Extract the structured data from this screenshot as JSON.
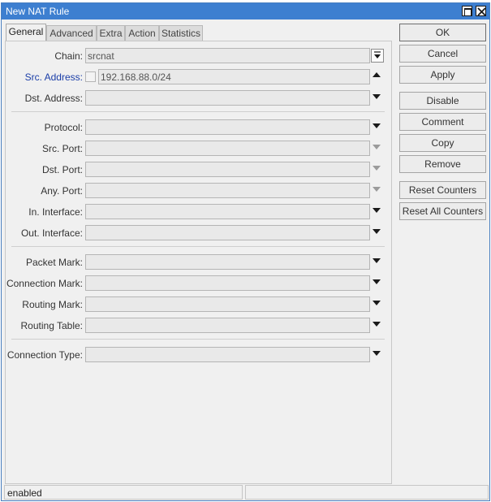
{
  "window": {
    "title": "New NAT Rule"
  },
  "tabs": [
    {
      "label": "General",
      "active": true
    },
    {
      "label": "Advanced",
      "active": false
    },
    {
      "label": "Extra",
      "active": false
    },
    {
      "label": "Action",
      "active": false
    },
    {
      "label": "Statistics",
      "active": false
    }
  ],
  "fields": {
    "chain": {
      "label": "Chain:",
      "value": "srcnat"
    },
    "src_address": {
      "label": "Src. Address:",
      "value": "192.168.88.0/24",
      "negate_checked": false
    },
    "dst_address": {
      "label": "Dst. Address:",
      "value": ""
    },
    "protocol": {
      "label": "Protocol:",
      "value": ""
    },
    "src_port": {
      "label": "Src. Port:",
      "value": ""
    },
    "dst_port": {
      "label": "Dst. Port:",
      "value": ""
    },
    "any_port": {
      "label": "Any. Port:",
      "value": ""
    },
    "in_interface": {
      "label": "In. Interface:",
      "value": ""
    },
    "out_interface": {
      "label": "Out. Interface:",
      "value": ""
    },
    "packet_mark": {
      "label": "Packet Mark:",
      "value": ""
    },
    "connection_mark": {
      "label": "Connection Mark:",
      "value": ""
    },
    "routing_mark": {
      "label": "Routing Mark:",
      "value": ""
    },
    "routing_table": {
      "label": "Routing Table:",
      "value": ""
    },
    "connection_type": {
      "label": "Connection Type:",
      "value": ""
    }
  },
  "buttons": {
    "ok": "OK",
    "cancel": "Cancel",
    "apply": "Apply",
    "disable": "Disable",
    "comment": "Comment",
    "copy": "Copy",
    "remove": "Remove",
    "reset_counters": "Reset Counters",
    "reset_all_counters": "Reset All Counters"
  },
  "status": {
    "left": "enabled",
    "right": ""
  },
  "colors": {
    "titlebar": "#3d7fd0",
    "active_label": "#1b3ea8"
  }
}
